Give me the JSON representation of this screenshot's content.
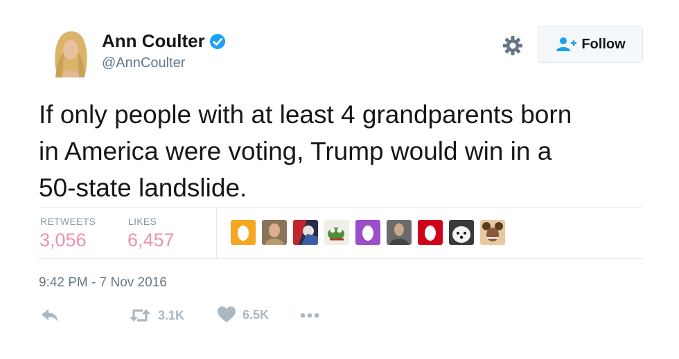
{
  "user": {
    "name": "Ann Coulter",
    "handle": "@AnnCoulter",
    "verified": true
  },
  "header": {
    "settings_icon": "gear-icon",
    "follow_label": "Follow"
  },
  "tweet": {
    "text": "If only people with at least 4 grandparents born\nin America were voting, Trump would win in a\n50-state landslide."
  },
  "stats": {
    "retweets_label": "RETWEETS",
    "retweets_value": "3,056",
    "likes_label": "LIKES",
    "likes_value": "6,457"
  },
  "likers": [
    "default-egg-avatar-orange",
    "user-photo-avatar",
    "user-photo-avatar",
    "user-cartoon-avatar",
    "default-egg-avatar-purple",
    "user-photo-avatar",
    "default-egg-avatar-red",
    "dog-photo-avatar",
    "user-photo-avatar"
  ],
  "timestamp": "9:42 PM - 7 Nov 2016",
  "actions": {
    "reply_icon": "reply-icon",
    "retweet_count": "3.1K",
    "like_count": "6.5K",
    "more_icon": "more-icon"
  },
  "colors": {
    "verified_blue": "#1da1f2",
    "like_pink": "#e0245e",
    "muted_gray": "#657786",
    "egg_orange": "#f5a623",
    "egg_purple": "#9b4dca",
    "egg_red": "#d0021b"
  }
}
